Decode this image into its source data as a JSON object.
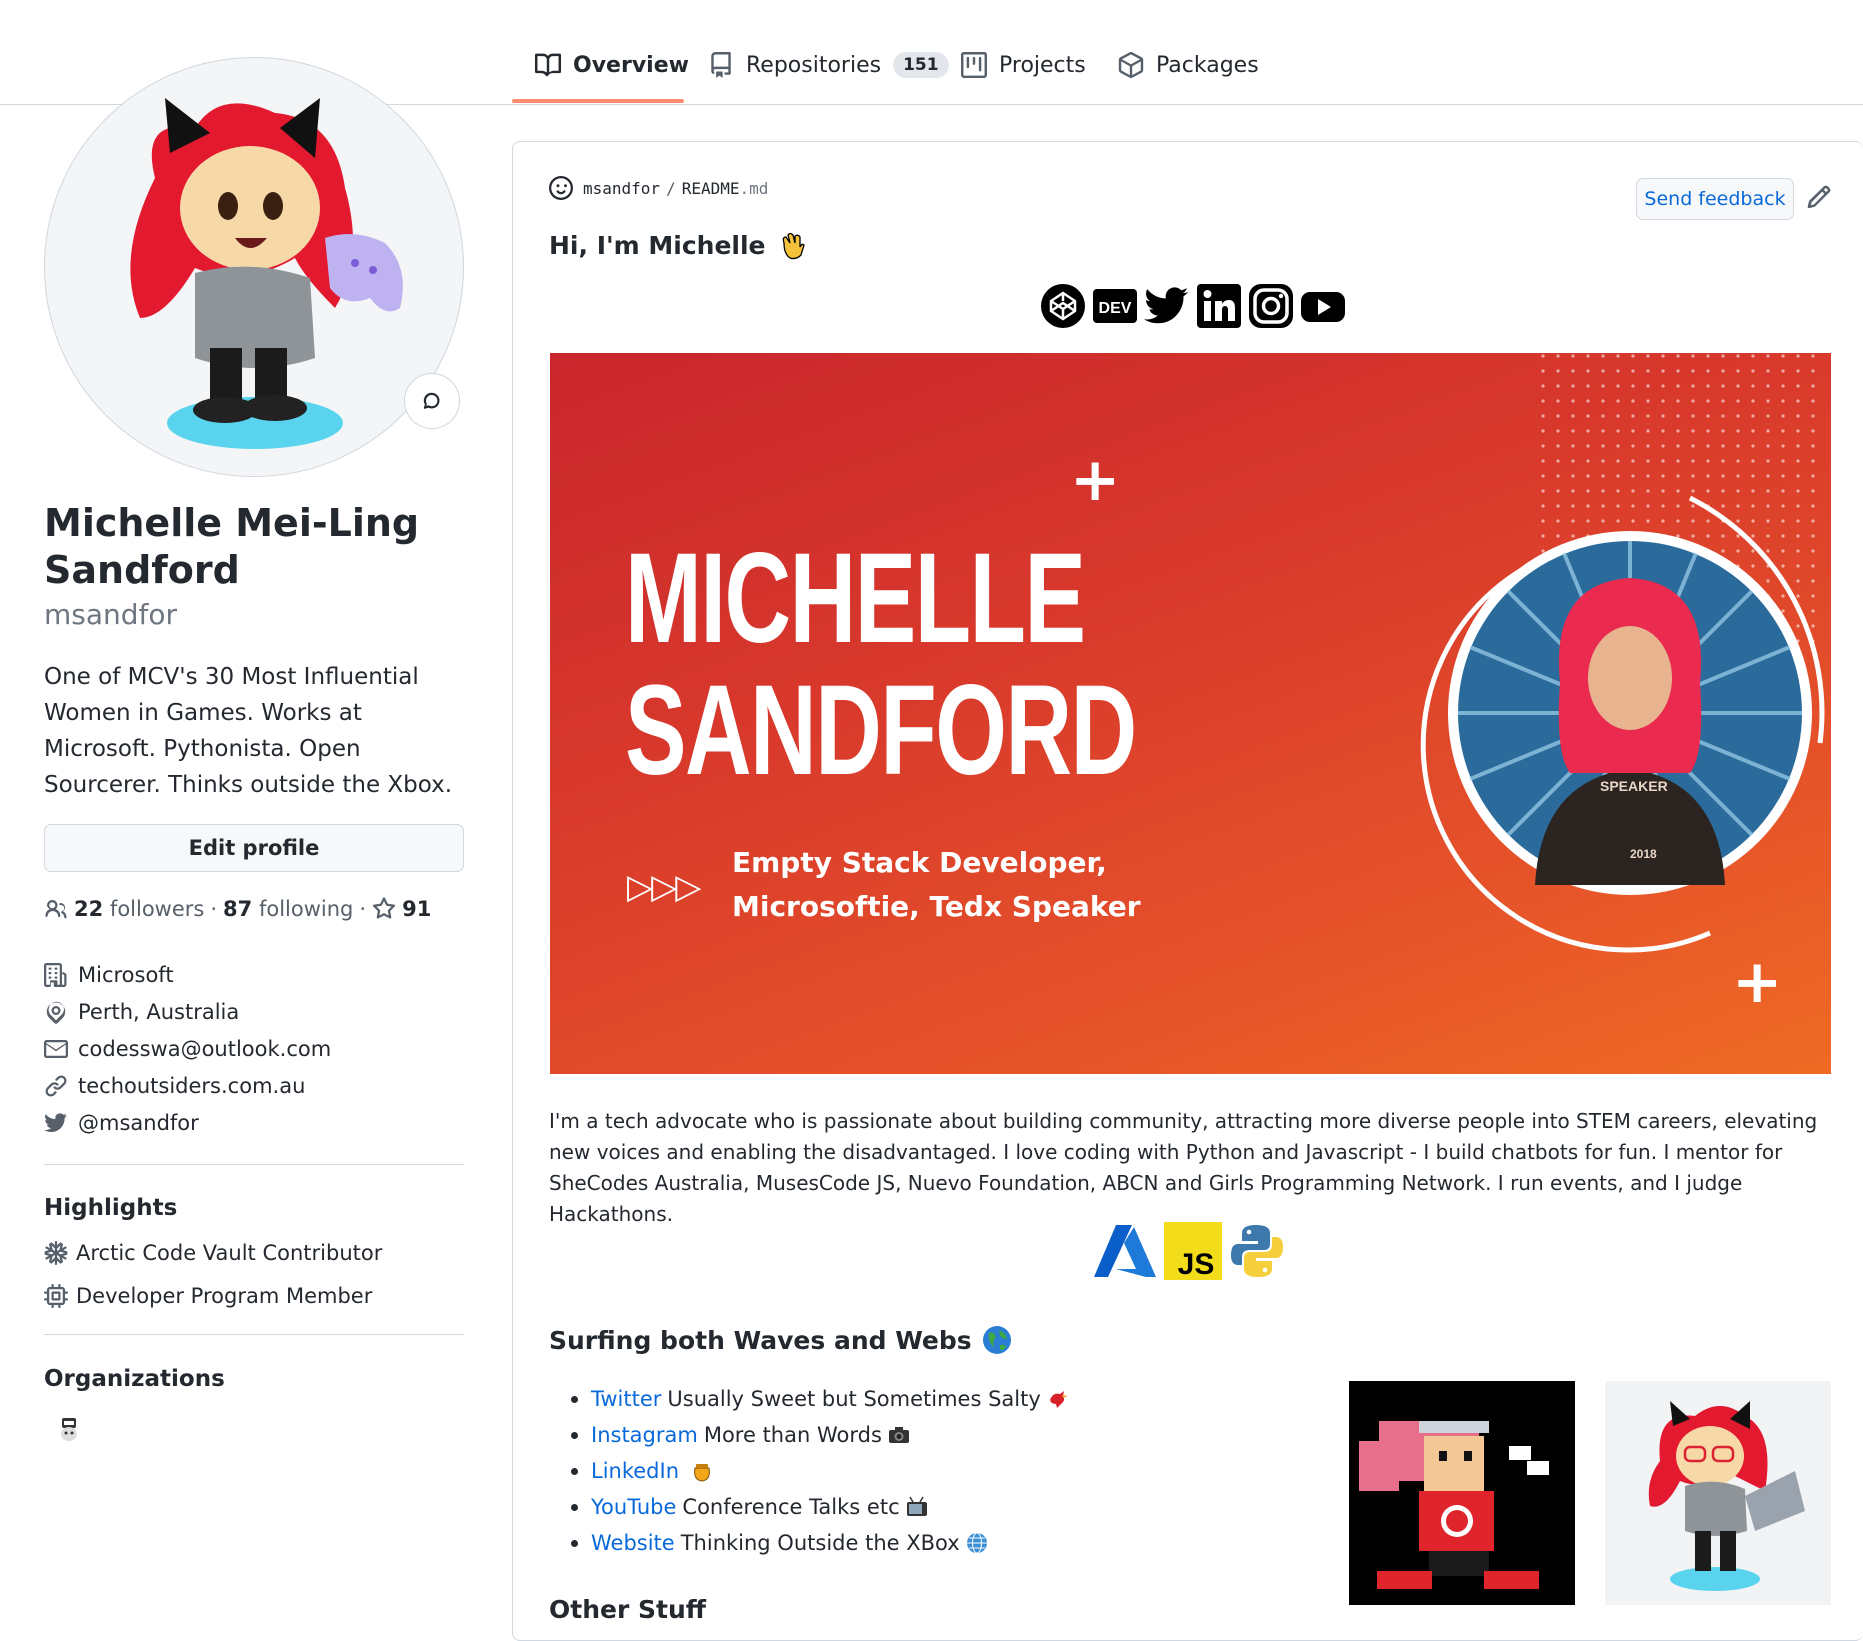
{
  "nav": {
    "tabs": [
      {
        "label": "Overview",
        "icon": "book-icon",
        "active": true
      },
      {
        "label": "Repositories",
        "icon": "repo-icon",
        "count": "151"
      },
      {
        "label": "Projects",
        "icon": "project-icon"
      },
      {
        "label": "Packages",
        "icon": "package-icon"
      }
    ],
    "accent": "#fd8c73"
  },
  "profile": {
    "name": "Michelle Mei-Ling Sandford",
    "login": "msandfor",
    "bio": "One of MCV's 30 Most Influential Women in Games. Works at Microsoft. Pythonista. Open Sourcerer. Thinks outside the Xbox.",
    "edit_label": "Edit profile",
    "followers_count": "22",
    "followers_label": "followers",
    "following_count": "87",
    "following_label": "following",
    "stars_count": "91",
    "details": [
      {
        "icon": "organization-icon",
        "text": "Microsoft"
      },
      {
        "icon": "location-icon",
        "text": "Perth, Australia"
      },
      {
        "icon": "mail-icon",
        "text": "codesswa@outlook.com"
      },
      {
        "icon": "link-icon",
        "text": "techoutsiders.com.au"
      },
      {
        "icon": "twitter-icon",
        "text": "@msandfor"
      }
    ]
  },
  "highlights": {
    "title": "Highlights",
    "items": [
      {
        "icon": "snowflake-icon",
        "text": "Arctic Code Vault Contributor"
      },
      {
        "icon": "cpu-icon",
        "text": "Developer Program Member"
      }
    ]
  },
  "organizations": {
    "title": "Organizations"
  },
  "readme": {
    "owner": "msandfor",
    "separator": "/",
    "file_name": "README",
    "file_ext": ".md",
    "feedback_label": "Send feedback",
    "greeting": "Hi, I'm Michelle",
    "social_icons": [
      "codepen-icon",
      "dev-icon",
      "twitter-icon",
      "linkedin-icon",
      "instagram-icon",
      "youtube-icon"
    ],
    "dev_badge": "DEV",
    "banner": {
      "line1": "MICHELLE",
      "line2": "SANDFORD",
      "sub1": "Empty Stack Developer,",
      "sub2": "Microsoftie, Tedx Speaker",
      "arrows": "▷▷▷",
      "shirt_text": "SPEAKER",
      "shirt_year": "2018"
    },
    "paragraph": "I'm a tech advocate who is passionate about building community, attracting more diverse people into STEM careers, elevating new voices and enabling the disadvantaged. I love coding with Python and Javascript - I build chatbots for fun. I mentor for SheCodes Australia, MusesCode JS, Nuevo Foundation, ABCN and Girls Programming Network. I run events, and I judge Hackathons.",
    "tech_icons": [
      "azure-icon",
      "javascript-icon",
      "python-icon"
    ],
    "js_badge": "JS",
    "section1": "Surfing both Waves and Webs",
    "links": [
      {
        "link": "Twitter",
        "text": "Usually Sweet but Sometimes Salty",
        "emoji": "bird-emoji"
      },
      {
        "link": "Instagram",
        "text": "More than Words",
        "emoji": "camera-emoji"
      },
      {
        "link": "LinkedIn",
        "text": "",
        "emoji": "honeypot-emoji"
      },
      {
        "link": "YouTube",
        "text": "Conference Talks etc",
        "emoji": "tv-emoji"
      },
      {
        "link": "Website",
        "text": "Thinking Outside the XBox",
        "emoji": "globe-emoji"
      }
    ],
    "section2": "Other Stuff"
  }
}
